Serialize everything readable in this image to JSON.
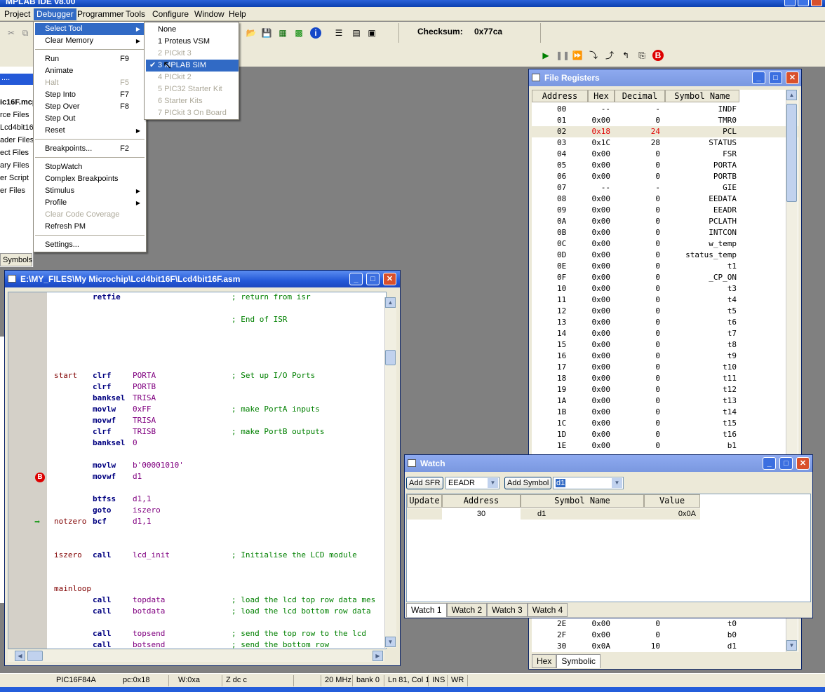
{
  "app": {
    "title": "MPLAB IDE v8.00"
  },
  "menubar": [
    "Project",
    "Debugger",
    "Programmer",
    "Tools",
    "Configure",
    "Window",
    "Help"
  ],
  "toolbar": {
    "checksum_label": "Checksum:",
    "checksum_value": "0x77ca"
  },
  "debugger_menu": [
    {
      "label": "Select Tool",
      "shortcut": "",
      "submenu": true,
      "state": "highlighted"
    },
    {
      "label": "Clear Memory",
      "shortcut": "",
      "submenu": true,
      "state": "normal"
    },
    {
      "label": "Run",
      "shortcut": "F9",
      "submenu": false,
      "state": "normal"
    },
    {
      "label": "Animate",
      "shortcut": "",
      "submenu": false,
      "state": "normal"
    },
    {
      "label": "Halt",
      "shortcut": "F5",
      "submenu": false,
      "state": "disabled"
    },
    {
      "label": "Step Into",
      "shortcut": "F7",
      "submenu": false,
      "state": "normal"
    },
    {
      "label": "Step Over",
      "shortcut": "F8",
      "submenu": false,
      "state": "normal"
    },
    {
      "label": "Step Out",
      "shortcut": "",
      "submenu": false,
      "state": "normal"
    },
    {
      "label": "Reset",
      "shortcut": "",
      "submenu": true,
      "state": "normal"
    },
    {
      "label": "Breakpoints...",
      "shortcut": "F2",
      "submenu": false,
      "state": "normal"
    },
    {
      "label": "StopWatch",
      "shortcut": "",
      "submenu": false,
      "state": "normal"
    },
    {
      "label": "Complex Breakpoints",
      "shortcut": "",
      "submenu": false,
      "state": "normal"
    },
    {
      "label": "Stimulus",
      "shortcut": "",
      "submenu": true,
      "state": "normal"
    },
    {
      "label": "Profile",
      "shortcut": "",
      "submenu": true,
      "state": "normal"
    },
    {
      "label": "Clear Code Coverage",
      "shortcut": "",
      "submenu": false,
      "state": "disabled"
    },
    {
      "label": "Refresh PM",
      "shortcut": "",
      "submenu": false,
      "state": "normal"
    },
    {
      "label": "Settings...",
      "shortcut": "",
      "submenu": false,
      "state": "normal"
    }
  ],
  "select_tool_submenu": [
    {
      "label": "None",
      "checked": false,
      "state": "normal"
    },
    {
      "label": "1 Proteus VSM",
      "checked": false,
      "state": "normal"
    },
    {
      "label": "2 PICkit 3",
      "checked": false,
      "state": "disabled"
    },
    {
      "label": "3 MPLAB SIM",
      "checked": true,
      "state": "highlighted"
    },
    {
      "label": "4 PICkit 2",
      "checked": false,
      "state": "disabled"
    },
    {
      "label": "5 PIC32 Starter Kit",
      "checked": false,
      "state": "disabled"
    },
    {
      "label": "6 Starter Kits",
      "checked": false,
      "state": "disabled"
    },
    {
      "label": "7 PICkit 3 On Board",
      "checked": false,
      "state": "disabled"
    }
  ],
  "project_panel": {
    "title": "ic16F.mcp",
    "items": [
      "rce Files",
      "Lcd4bit16",
      "ader Files",
      "ect Files",
      "ary Files",
      "er Script",
      "er Files"
    ],
    "tab": "Symbols"
  },
  "editor": {
    "title": "E:\\MY_FILES\\My Microchip\\Lcd4bit16F\\Lcd4bit16F.asm",
    "lines": [
      {
        "label": "",
        "op": "retfie",
        "arg": "",
        "cmt": "; return from isr",
        "marker": ""
      },
      {
        "label": "",
        "op": "",
        "arg": "",
        "cmt": "",
        "marker": ""
      },
      {
        "label": "",
        "op": "",
        "arg": "",
        "cmt": "; End of ISR",
        "marker": ""
      },
      {
        "label": "",
        "op": "",
        "arg": "",
        "cmt": "",
        "marker": ""
      },
      {
        "label": "",
        "op": "",
        "arg": "",
        "cmt": "",
        "marker": ""
      },
      {
        "label": "",
        "op": "",
        "arg": "",
        "cmt": "",
        "marker": ""
      },
      {
        "label": "",
        "op": "",
        "arg": "",
        "cmt": "",
        "marker": ""
      },
      {
        "label": "start",
        "op": "clrf",
        "arg": "PORTA",
        "cmt": "; Set up I/O Ports",
        "marker": ""
      },
      {
        "label": "",
        "op": "clrf",
        "arg": "PORTB",
        "cmt": "",
        "marker": ""
      },
      {
        "label": "",
        "op": "banksel",
        "arg": "TRISA",
        "cmt": "",
        "marker": ""
      },
      {
        "label": "",
        "op": "movlw",
        "arg": "0xFF",
        "cmt": "; make PortA inputs",
        "marker": ""
      },
      {
        "label": "",
        "op": "movwf",
        "arg": "TRISA",
        "cmt": "",
        "marker": ""
      },
      {
        "label": "",
        "op": "clrf",
        "arg": "TRISB",
        "cmt": "; make PortB outputs",
        "marker": ""
      },
      {
        "label": "",
        "op": "banksel",
        "arg": "0",
        "cmt": "",
        "marker": ""
      },
      {
        "label": "",
        "op": "",
        "arg": "",
        "cmt": "",
        "marker": ""
      },
      {
        "label": "",
        "op": "movlw",
        "arg": "b'00001010'",
        "cmt": "",
        "marker": ""
      },
      {
        "label": "",
        "op": "movwf",
        "arg": "d1",
        "cmt": "",
        "marker": "B"
      },
      {
        "label": "",
        "op": "",
        "arg": "",
        "cmt": "",
        "marker": ""
      },
      {
        "label": "",
        "op": "btfss",
        "arg": "d1,1",
        "cmt": "",
        "marker": ""
      },
      {
        "label": "",
        "op": "goto",
        "arg": "iszero",
        "cmt": "",
        "marker": ""
      },
      {
        "label": "notzero",
        "op": "bcf",
        "arg": "d1,1",
        "cmt": "",
        "marker": "arrow"
      },
      {
        "label": "",
        "op": "",
        "arg": "",
        "cmt": "",
        "marker": ""
      },
      {
        "label": "",
        "op": "",
        "arg": "",
        "cmt": "",
        "marker": ""
      },
      {
        "label": "iszero",
        "op": "call",
        "arg": "lcd_init",
        "cmt": "; Initialise the LCD module",
        "marker": ""
      },
      {
        "label": "",
        "op": "",
        "arg": "",
        "cmt": "",
        "marker": ""
      },
      {
        "label": "",
        "op": "",
        "arg": "",
        "cmt": "",
        "marker": ""
      },
      {
        "label": "mainloop",
        "op": "",
        "arg": "",
        "cmt": "",
        "marker": ""
      },
      {
        "label": "",
        "op": "call",
        "arg": "topdata",
        "cmt": "; load the lcd top row data mes",
        "marker": ""
      },
      {
        "label": "",
        "op": "call",
        "arg": "botdata",
        "cmt": "; load the lcd bottom row data",
        "marker": ""
      },
      {
        "label": "",
        "op": "",
        "arg": "",
        "cmt": "",
        "marker": ""
      },
      {
        "label": "",
        "op": "call",
        "arg": "topsend",
        "cmt": "; send the top row to the lcd",
        "marker": ""
      },
      {
        "label": "",
        "op": "call",
        "arg": "botsend",
        "cmt": "; send the bottom row",
        "marker": ""
      }
    ]
  },
  "file_registers": {
    "title": "File Registers",
    "columns": [
      "Address",
      "Hex",
      "Decimal",
      "Symbol Name"
    ],
    "rows": [
      [
        "00",
        "--",
        "-",
        "INDF"
      ],
      [
        "01",
        "0x00",
        "0",
        "TMR0"
      ],
      [
        "02",
        "0x18",
        "24",
        "PCL"
      ],
      [
        "03",
        "0x1C",
        "28",
        "STATUS"
      ],
      [
        "04",
        "0x00",
        "0",
        "FSR"
      ],
      [
        "05",
        "0x00",
        "0",
        "PORTA"
      ],
      [
        "06",
        "0x00",
        "0",
        "PORTB"
      ],
      [
        "07",
        "--",
        "-",
        "GIE"
      ],
      [
        "08",
        "0x00",
        "0",
        "EEDATA"
      ],
      [
        "09",
        "0x00",
        "0",
        "EEADR"
      ],
      [
        "0A",
        "0x00",
        "0",
        "PCLATH"
      ],
      [
        "0B",
        "0x00",
        "0",
        "INTCON"
      ],
      [
        "0C",
        "0x00",
        "0",
        "w_temp"
      ],
      [
        "0D",
        "0x00",
        "0",
        "status_temp"
      ],
      [
        "0E",
        "0x00",
        "0",
        "t1"
      ],
      [
        "0F",
        "0x00",
        "0",
        "_CP_ON"
      ],
      [
        "10",
        "0x00",
        "0",
        "t3"
      ],
      [
        "11",
        "0x00",
        "0",
        "t4"
      ],
      [
        "12",
        "0x00",
        "0",
        "t5"
      ],
      [
        "13",
        "0x00",
        "0",
        "t6"
      ],
      [
        "14",
        "0x00",
        "0",
        "t7"
      ],
      [
        "15",
        "0x00",
        "0",
        "t8"
      ],
      [
        "16",
        "0x00",
        "0",
        "t9"
      ],
      [
        "17",
        "0x00",
        "0",
        "t10"
      ],
      [
        "18",
        "0x00",
        "0",
        "t11"
      ],
      [
        "19",
        "0x00",
        "0",
        "t12"
      ],
      [
        "1A",
        "0x00",
        "0",
        "t13"
      ],
      [
        "1B",
        "0x00",
        "0",
        "t14"
      ],
      [
        "1C",
        "0x00",
        "0",
        "t15"
      ],
      [
        "1D",
        "0x00",
        "0",
        "t16"
      ],
      [
        "1E",
        "0x00",
        "0",
        "b1"
      ]
    ],
    "tail_rows": [
      [
        "2E",
        "0x00",
        "0",
        "t0"
      ],
      [
        "2F",
        "0x00",
        "0",
        "b0"
      ],
      [
        "30",
        "0x0A",
        "10",
        "d1"
      ]
    ],
    "changed_row": "02",
    "tabs": [
      "Hex",
      "Symbolic"
    ],
    "selected_tab": "Symbolic"
  },
  "watch": {
    "title": "Watch",
    "add_sfr_label": "Add SFR",
    "sfr_value": "EEADR",
    "add_symbol_label": "Add Symbol",
    "symbol_value": "d1",
    "columns": [
      "Update",
      "Address",
      "Symbol Name",
      "Value"
    ],
    "rows": [
      [
        "",
        "30",
        "d1",
        "0x0A"
      ]
    ],
    "tabs": [
      "Watch 1",
      "Watch 2",
      "Watch 3",
      "Watch 4"
    ],
    "selected_tab": "Watch 1"
  },
  "statusbar": [
    "PIC16F84A",
    "pc:0x18",
    "W:0xa",
    "Z dc c",
    "20 MHz",
    "bank 0",
    "Ln 81, Col 1",
    "INS",
    "WR"
  ],
  "colors": {
    "selection": "#316ac5",
    "changed_value": "#e00000",
    "title_active": "#2459d8"
  }
}
